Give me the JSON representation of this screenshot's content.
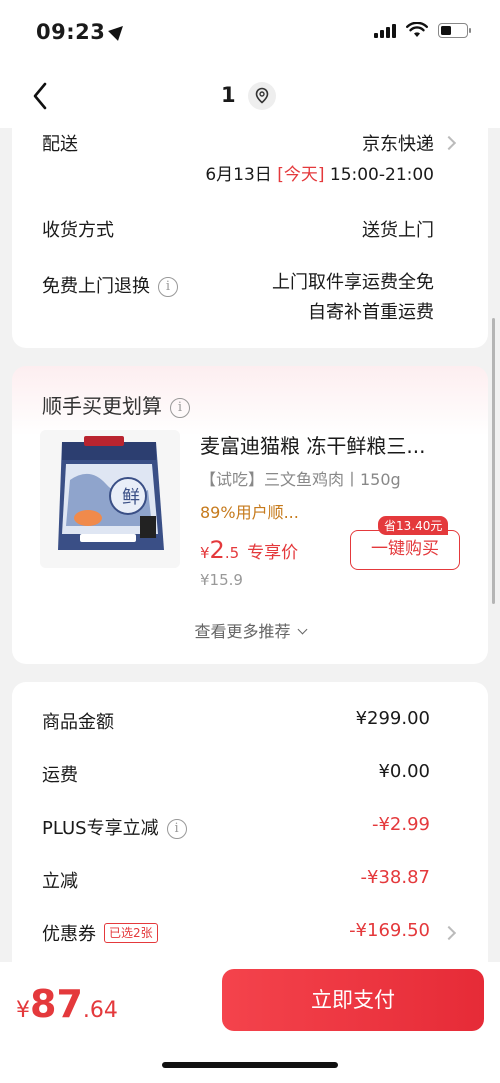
{
  "status": {
    "time": "09:23"
  },
  "nav": {
    "title": "1",
    "back_icon": "chevron-left-icon",
    "location_icon": "location-pin-icon"
  },
  "delivery": {
    "label": "配送",
    "carrier": "京东快递",
    "date": "6月13日",
    "today": "[今天]",
    "time_range": "15:00-21:00",
    "receive_label": "收货方式",
    "receive_value": "送货上门",
    "return_label": "免费上门退换",
    "return_line1": "上门取件享运费全免",
    "return_line2": "自寄补首重运费"
  },
  "recommend": {
    "title": "顺手买更划算",
    "product_name": "麦富迪猫粮 冻干鲜粮三...",
    "spec": "【试吃】三文鱼鸡肉丨150g",
    "rating": "89%用户顺...",
    "price_symbol": "¥",
    "price_int": "2",
    "price_dec": ".5",
    "price_tag": "专享价",
    "original_price": "¥15.9",
    "save_badge": "省13.40元",
    "buy_label": "一键购买",
    "more_label": "查看更多推荐",
    "image_label": "鲜"
  },
  "summary": {
    "goods_label": "商品金额",
    "goods_value": "¥299.00",
    "shipping_label": "运费",
    "shipping_value": "¥0.00",
    "plus_label": "PLUS专享立减",
    "plus_value": "-¥2.99",
    "discount_label": "立减",
    "discount_value": "-¥38.87",
    "coupon_label": "优惠券",
    "coupon_tag": "已选2张",
    "coupon_value": "-¥169.50"
  },
  "bottom": {
    "total_symbol": "¥",
    "total_int": "87",
    "total_dec": ".64",
    "pay_label": "立即支付"
  },
  "colors": {
    "accent": "#e4393c",
    "rating": "#c67a1c",
    "background": "#f2f2f2"
  }
}
